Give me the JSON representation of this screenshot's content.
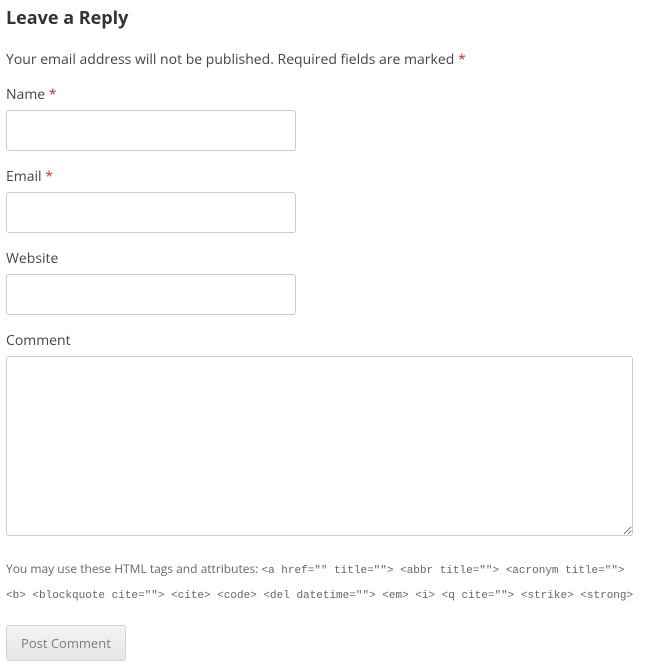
{
  "heading": "Leave a Reply",
  "notes": {
    "text1": "Your email address will not be published.",
    "text2": " Required fields are marked ",
    "asterisk": "*"
  },
  "fields": {
    "name": {
      "label": "Name ",
      "required": "*"
    },
    "email": {
      "label": "Email ",
      "required": "*"
    },
    "website": {
      "label": "Website"
    },
    "comment": {
      "label": "Comment"
    }
  },
  "allowed_tags": {
    "prefix": "You may use these HTML tags and attributes: ",
    "code": "<a href=\"\" title=\"\"> <abbr title=\"\"> <acronym title=\"\"> <b> <blockquote cite=\"\"> <cite> <code> <del datetime=\"\"> <em> <i> <q cite=\"\"> <strike> <strong>"
  },
  "submit_label": "Post Comment"
}
